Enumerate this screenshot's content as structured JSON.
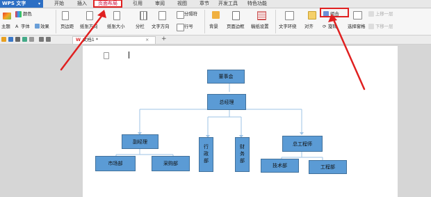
{
  "app": {
    "title": "WPS 文字",
    "dropdown": "▾"
  },
  "menu": {
    "tabs": [
      "开始",
      "插入",
      "页面布局",
      "引用",
      "审阅",
      "视图",
      "章节",
      "开发工具",
      "特色功能"
    ],
    "active_tab": "页面布局"
  },
  "ribbon": {
    "theme": "主题",
    "colors": "颜色",
    "fonts": "字体",
    "effects": "效果",
    "margins": "页边距",
    "orientation": "纸张方向",
    "size": "纸张大小",
    "columns": "分栏",
    "text_direction": "文字方向",
    "line_numbers": "行号",
    "breaks": "分隔符",
    "background": "背景",
    "page_border": "页面边框",
    "manuscript": "稿纸设置",
    "wrap_text": "文字环绕",
    "align": "对齐",
    "rotate": "旋转",
    "selection_pane": "选择窗格",
    "group": "组合",
    "bring_forward": "上移一层",
    "send_backward": "下移一层"
  },
  "doc": {
    "tab_title": "文档1 *",
    "close": "×",
    "new_tab": "+"
  },
  "colors": {
    "brand": "#2d6fc4",
    "node_fill": "#5b9bd5",
    "node_border": "#41719c",
    "connector": "#9dc3e6",
    "annotation_red": "#e02020"
  },
  "org_chart": {
    "root": "董事会",
    "gm": "总经理",
    "deputy": "副经理",
    "admin": "行政部",
    "finance": "财务部",
    "chief_engineer": "总工程师",
    "market": "市场部",
    "purchase": "采购部",
    "tech": "技术部",
    "engineering": "工程部"
  }
}
